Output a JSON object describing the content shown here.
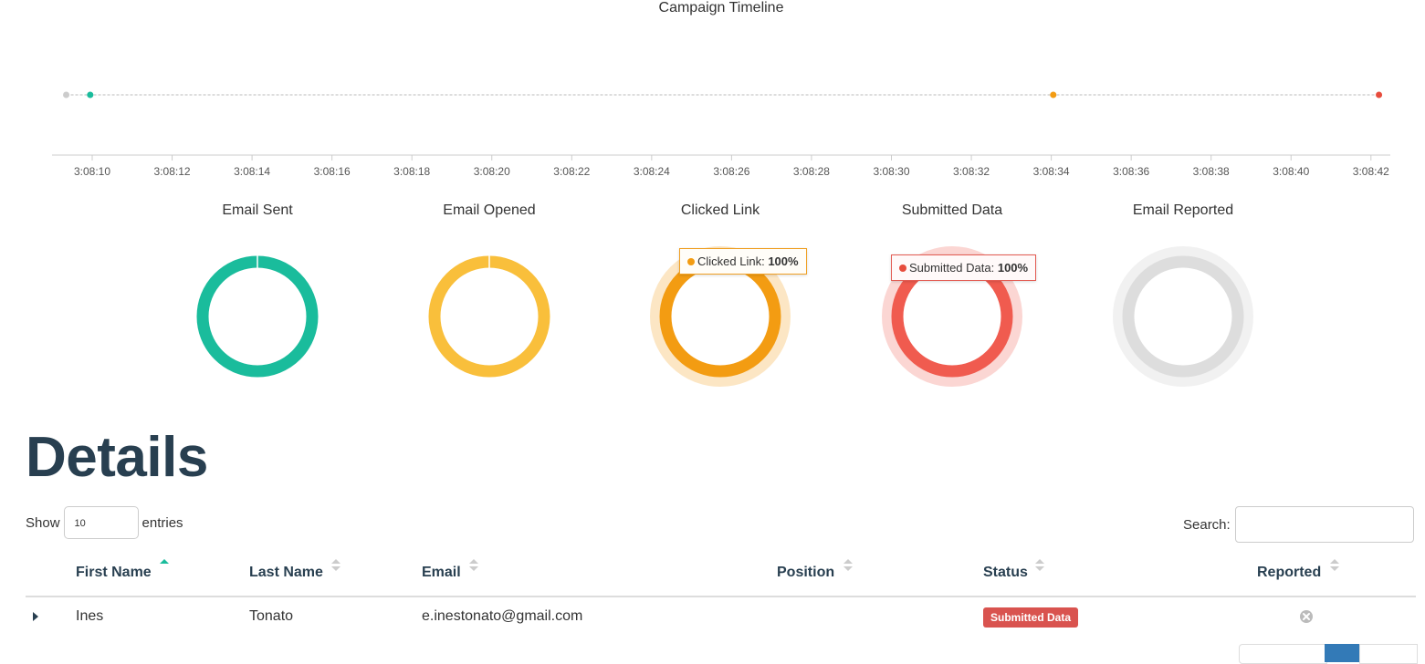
{
  "timeline": {
    "title": "Campaign Timeline",
    "ticks": [
      "3:08:10",
      "3:08:12",
      "3:08:14",
      "3:08:16",
      "3:08:18",
      "3:08:20",
      "3:08:22",
      "3:08:24",
      "3:08:26",
      "3:08:28",
      "3:08:30",
      "3:08:32",
      "3:08:34",
      "3:08:36",
      "3:08:38",
      "3:08:40",
      "3:08:42"
    ],
    "events": [
      {
        "t": 9.35,
        "color": "#cccccc"
      },
      {
        "t": 9.95,
        "color": "#1abc9c"
      },
      {
        "t": 34.05,
        "color": "#f39c12"
      },
      {
        "t": 42.2,
        "color": "#e74c3c"
      }
    ]
  },
  "chart_data": [
    {
      "type": "pie",
      "title": "Email Sent",
      "value_percent": 100,
      "color": "#1abc9c"
    },
    {
      "type": "pie",
      "title": "Email Opened",
      "value_percent": 100,
      "color": "#f9bf3b"
    },
    {
      "type": "pie",
      "title": "Clicked Link",
      "value_percent": 100,
      "color": "#f39c12",
      "tooltip_label": "Clicked Link:",
      "tooltip_value": "100%"
    },
    {
      "type": "pie",
      "title": "Submitted Data",
      "value_percent": 100,
      "color": "#f05b4f",
      "tooltip_label": "Submitted Data:",
      "tooltip_value": "100%"
    },
    {
      "type": "pie",
      "title": "Email Reported",
      "value_percent": 0,
      "color": "#dddddd"
    }
  ],
  "details": {
    "heading": "Details",
    "show_label": "Show",
    "entries_value": "10",
    "entries_label": "entries",
    "search_label": "Search:",
    "columns": [
      "First Name",
      "Last Name",
      "Email",
      "Position",
      "Status",
      "Reported"
    ],
    "rows": [
      {
        "first_name": "Ines",
        "last_name": "Tonato",
        "email": "e.inestonato@gmail.com",
        "position": "",
        "status": "Submitted Data",
        "reported": "no"
      }
    ]
  },
  "colors": {
    "heading": "#283f50",
    "accent": "#1abc9c",
    "badge": "#d9534f",
    "pager_active": "#337ab7"
  }
}
